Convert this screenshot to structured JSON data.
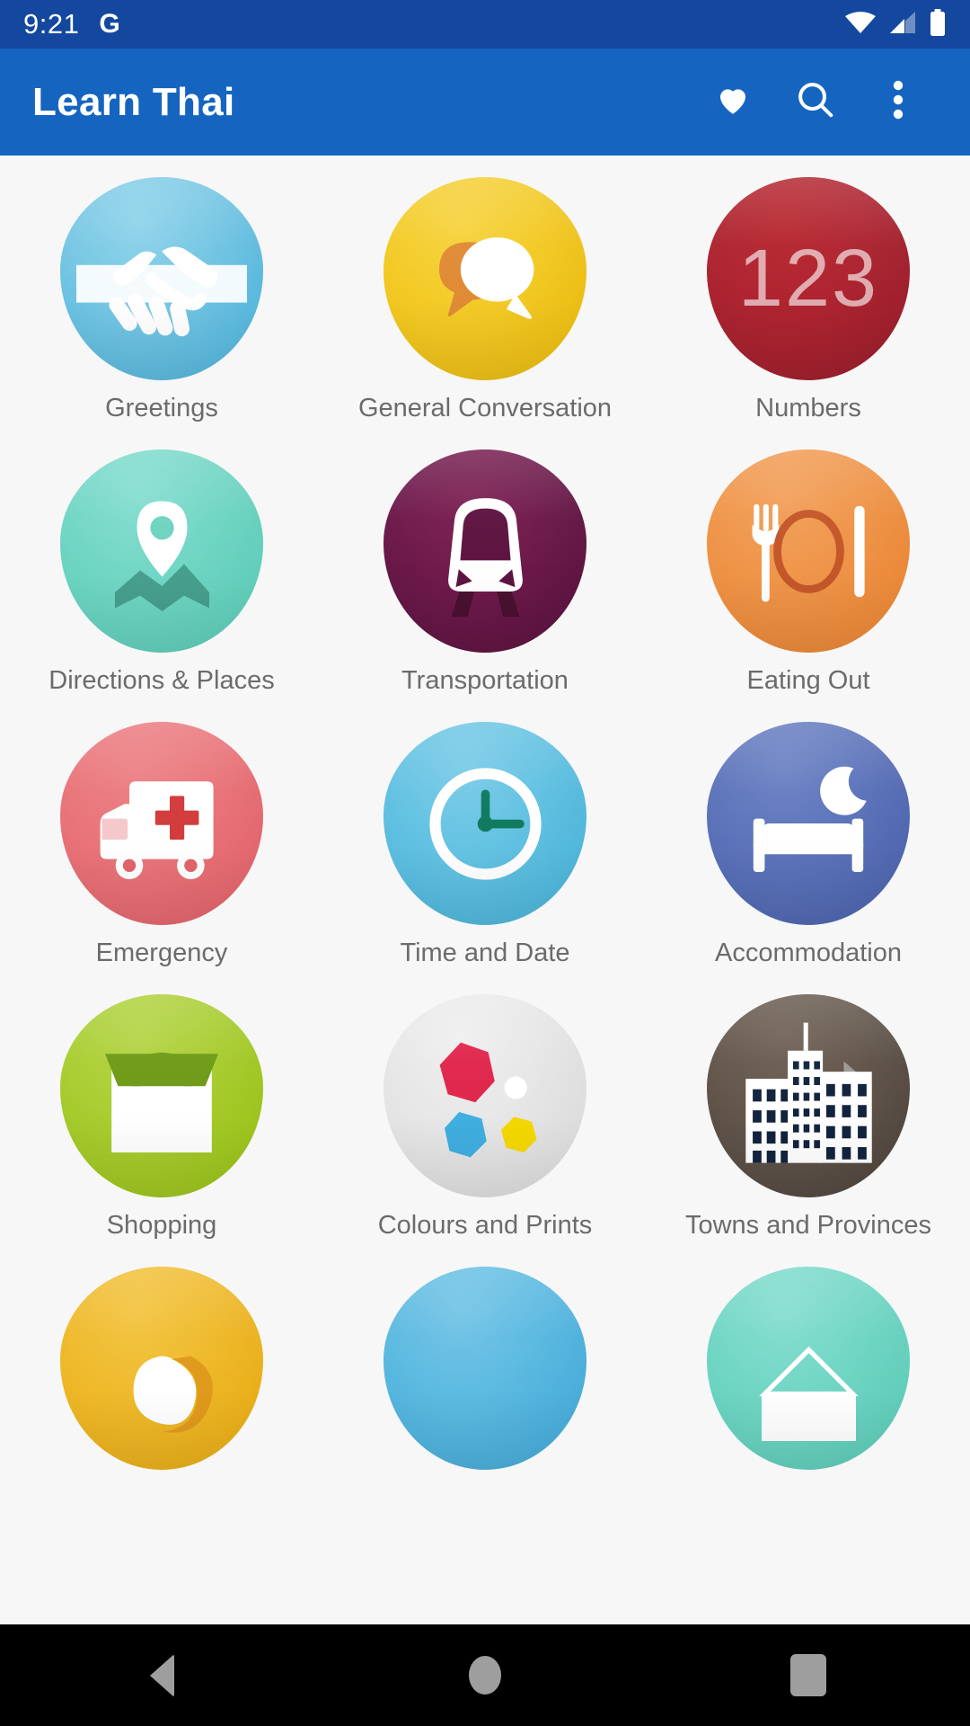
{
  "status_bar": {
    "time": "9:21",
    "google_glyph": "G",
    "icons": [
      "wifi-icon",
      "cellular-signal-icon",
      "battery-icon"
    ],
    "background_color": "#13489e"
  },
  "app_bar": {
    "title": "Learn Thai",
    "background_color": "#1565c0",
    "actions": [
      {
        "name": "favorites-button",
        "icon": "heart-icon"
      },
      {
        "name": "search-button",
        "icon": "search-icon"
      },
      {
        "name": "overflow-menu-button",
        "icon": "more-vert-icon"
      }
    ]
  },
  "grid": {
    "columns": 3,
    "items": [
      {
        "label": "Greetings",
        "icon": "handshake-icon",
        "color": "#58b8dd"
      },
      {
        "label": "General Conversation",
        "icon": "speech-bubbles-icon",
        "color": "#ecbd13"
      },
      {
        "label": "Numbers",
        "icon": "digits-123-icon",
        "color": "#9d1f2d",
        "glyph": "123"
      },
      {
        "label": "Directions & Places",
        "icon": "map-pin-icon",
        "color": "#5fcdb9"
      },
      {
        "label": "Transportation",
        "icon": "train-icon",
        "color": "#5d1440"
      },
      {
        "label": "Eating Out",
        "icon": "cutlery-plate-icon",
        "color": "#ea8736"
      },
      {
        "label": "Emergency",
        "icon": "ambulance-icon",
        "color": "#e2656c"
      },
      {
        "label": "Time and Date",
        "icon": "clock-icon",
        "color": "#4db5da"
      },
      {
        "label": "Accommodation",
        "icon": "bed-moon-icon",
        "color": "#4e65ae"
      },
      {
        "label": "Shopping",
        "icon": "shopping-bag-icon",
        "color": "#9bc31b"
      },
      {
        "label": "Colours and Prints",
        "icon": "colour-shapes-icon",
        "color": "#dcdcdc"
      },
      {
        "label": "Towns and Provinces",
        "icon": "cityscape-icon",
        "color": "#524740"
      },
      {
        "label": "",
        "icon": "partial-amber-icon",
        "color": "#e9ae18"
      },
      {
        "label": "",
        "icon": "partial-blue-icon",
        "color": "#47acd9"
      },
      {
        "label": "",
        "icon": "partial-teal-icon",
        "color": "#5fcdb9"
      }
    ]
  },
  "nav_bar": {
    "background_color": "#000000",
    "buttons": [
      {
        "name": "nav-back-button",
        "icon": "back-triangle-icon"
      },
      {
        "name": "nav-home-button",
        "icon": "home-circle-icon"
      },
      {
        "name": "nav-recents-button",
        "icon": "recents-square-icon"
      }
    ]
  }
}
